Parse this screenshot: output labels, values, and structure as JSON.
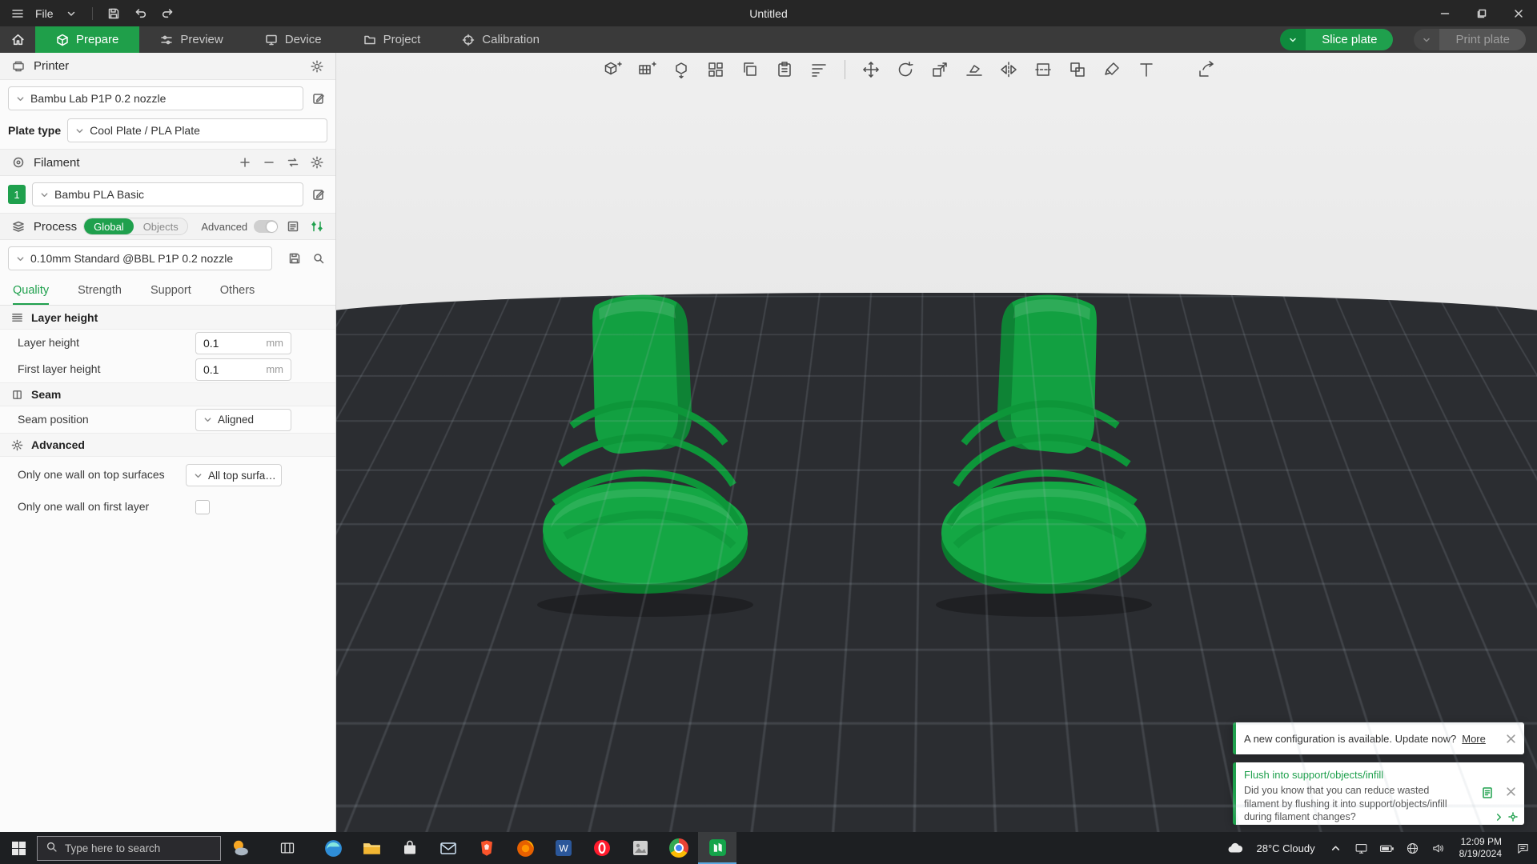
{
  "titlebar": {
    "file_label": "File",
    "title": "Untitled"
  },
  "tabbar": {
    "tabs": [
      {
        "label": "Prepare"
      },
      {
        "label": "Preview"
      },
      {
        "label": "Device"
      },
      {
        "label": "Project"
      },
      {
        "label": "Calibration"
      }
    ],
    "slice_label": "Slice plate",
    "print_label": "Print plate"
  },
  "sidebar": {
    "printer": {
      "title": "Printer",
      "model": "Bambu Lab P1P 0.2 nozzle",
      "plate_type_label": "Plate type",
      "plate_type": "Cool Plate / PLA Plate"
    },
    "filament": {
      "title": "Filament",
      "slot": "1",
      "name": "Bambu PLA Basic"
    },
    "process": {
      "title": "Process",
      "scope_global": "Global",
      "scope_objects": "Objects",
      "advanced_label": "Advanced",
      "preset": "0.10mm Standard @BBL P1P 0.2 nozzle",
      "tabs": [
        "Quality",
        "Strength",
        "Support",
        "Others"
      ]
    },
    "quality": {
      "layer_height_section": "Layer height",
      "layer_height_label": "Layer height",
      "layer_height_value": "0.1",
      "layer_height_unit": "mm",
      "first_layer_label": "First layer height",
      "first_layer_value": "0.1",
      "first_layer_unit": "mm",
      "seam_section": "Seam",
      "seam_position_label": "Seam position",
      "seam_position_value": "Aligned",
      "advanced_section": "Advanced",
      "one_wall_top_label": "Only one wall on top surfaces",
      "one_wall_top_value": "All top surfa…",
      "one_wall_first_label": "Only one wall on first layer"
    }
  },
  "notifications": {
    "update": {
      "text": "A new configuration is available. Update now?",
      "link": "More"
    },
    "flush": {
      "title": "Flush into support/objects/infill",
      "body": "Did you know that you can reduce wasted filament by flushing it into support/objects/infill during filament changes?"
    }
  },
  "taskbar": {
    "search_placeholder": "Type here to search",
    "weather": "28°C Cloudy",
    "time": "12:09 PM",
    "date": "8/19/2024"
  },
  "colors": {
    "accent_green": "#1fa04d",
    "plate_dark": "#2b2d31"
  }
}
